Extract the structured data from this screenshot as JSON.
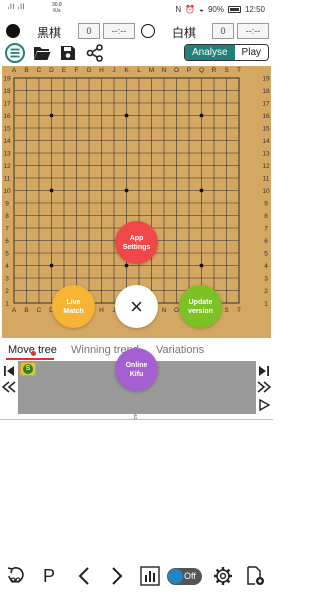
{
  "status": {
    "signal": "ᵢll ᵢll",
    "net_speed": "30.8",
    "net_unit": "K/s",
    "battery_pct": "90%",
    "time": "12:50"
  },
  "players": {
    "black_name": "黒棋",
    "black_captures": "0",
    "black_time": "--:--",
    "white_name": "白棋",
    "white_captures": "0",
    "white_time": "--:--"
  },
  "toolbar": {
    "mode_analyse": "Analyse",
    "mode_play": "Play"
  },
  "board": {
    "size": 19,
    "col_labels": [
      "A",
      "B",
      "C",
      "D",
      "E",
      "F",
      "G",
      "H",
      "J",
      "K",
      "L",
      "M",
      "N",
      "O",
      "P",
      "Q",
      "R",
      "S",
      "T"
    ],
    "row_labels": [
      "19",
      "18",
      "17",
      "16",
      "15",
      "14",
      "13",
      "12",
      "11",
      "10",
      "9",
      "8",
      "7",
      "6",
      "5",
      "4",
      "3",
      "2",
      "1"
    ],
    "board_color": "#d4a862",
    "line_color": "#333333"
  },
  "tabs": {
    "move_tree": "Move tree",
    "winning_trend": "Winning trend",
    "variations": "Variations"
  },
  "tree": {
    "root_label": "S"
  },
  "menu": {
    "app_settings": "App\nSettings",
    "live_match": "Live\nMatch",
    "update_version": "Update\nversion",
    "online_kifu": "Online\nKifu",
    "close": "×",
    "colors": {
      "app_settings": "#f04848",
      "live_match": "#f7b335",
      "update_version": "#7cc225",
      "online_kifu": "#a45fd0",
      "close": "#ffffff"
    }
  },
  "bottom": {
    "pass": "P",
    "toggle_label": "Off"
  }
}
